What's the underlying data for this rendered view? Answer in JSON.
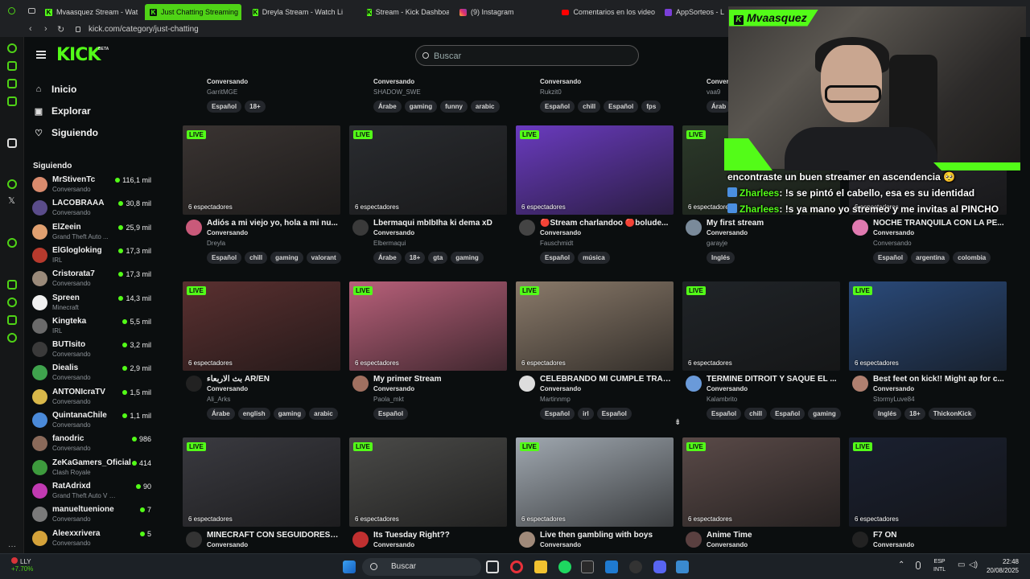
{
  "browser": {
    "tabs": [
      {
        "label": "Mvaasquez Stream - Wat",
        "icon": "kick-favicon"
      },
      {
        "label": "Just Chatting Streaming",
        "icon": "kick-favicon",
        "active": true
      },
      {
        "label": "Dreyla Stream - Watch Li",
        "icon": "kick-favicon"
      },
      {
        "label": "Stream - Kick Dashboard",
        "icon": "kick-favicon"
      },
      {
        "label": "(9) Instagram",
        "icon": "instagram-favicon"
      },
      {
        "label": "Comentarios en los video",
        "icon": "youtube-favicon"
      },
      {
        "label": "AppSorteos - L",
        "icon": "app-favicon"
      }
    ],
    "url": "kick.com/category/just-chatting"
  },
  "header": {
    "logo": "KICK",
    "beta": "BETA",
    "search_placeholder": "Buscar"
  },
  "sidebar": {
    "nav": [
      {
        "label": "Inicio",
        "icon": "home-icon"
      },
      {
        "label": "Explorar",
        "icon": "explore-icon"
      },
      {
        "label": "Siguiendo",
        "icon": "heart-icon"
      }
    ],
    "following_title": "Siguiendo",
    "following": [
      {
        "name": "MrStivenTc",
        "game": "Conversando",
        "viewers": "116,1 mil",
        "color": "#d98b6d"
      },
      {
        "name": "LACOBRAAA",
        "game": "Conversando",
        "viewers": "30,8 mil",
        "color": "#5a4c8a"
      },
      {
        "name": "ElZeein",
        "game": "Grand Theft Auto ...",
        "viewers": "25,9 mil",
        "color": "#e0a070"
      },
      {
        "name": "ElGlogloking",
        "game": "IRL",
        "viewers": "17,3 mil",
        "color": "#b73a2d"
      },
      {
        "name": "Cristorata7",
        "game": "Conversando",
        "viewers": "17,3 mil",
        "color": "#9a8a7a"
      },
      {
        "name": "Spreen",
        "game": "Minecraft",
        "viewers": "14,3 mil",
        "color": "#f0f0f0"
      },
      {
        "name": "Kingteka",
        "game": "IRL",
        "viewers": "5,5 mil",
        "color": "#6a6a6a"
      },
      {
        "name": "BUTIsito",
        "game": "Conversando",
        "viewers": "3,2 mil",
        "color": "#3a3a3a"
      },
      {
        "name": "Diealis",
        "game": "Conversando",
        "viewers": "2,9 mil",
        "color": "#3fa34d"
      },
      {
        "name": "ANTONIcraTV",
        "game": "Conversando",
        "viewers": "1,5 mil",
        "color": "#d9b84a"
      },
      {
        "name": "QuintanaChile",
        "game": "Conversando",
        "viewers": "1,1 mil",
        "color": "#4a8ad9"
      },
      {
        "name": "fanodric",
        "game": "Conversando",
        "viewers": "986",
        "color": "#8a6a5a"
      },
      {
        "name": "ZeKaGamers_Oficial",
        "game": "Clash Royale",
        "viewers": "414",
        "color": "#3d9a3d"
      },
      {
        "name": "RatAdrixd",
        "game": "Grand Theft Auto V (GTA)",
        "viewers": "90",
        "color": "#c13ab2"
      },
      {
        "name": "manueltuenione",
        "game": "Conversando",
        "viewers": "7",
        "color": "#7a7a7a"
      },
      {
        "name": "Aleexxrivera",
        "game": "Conversando",
        "viewers": "5",
        "color": "#d4a23a"
      }
    ]
  },
  "top_partial_row": [
    {
      "category": "Conversando",
      "user": "GarritMGE",
      "tags": [
        "Español",
        "18+"
      ]
    },
    {
      "category": "Conversando",
      "user": "SHADOW_SWE",
      "tags": [
        "Árabe",
        "gaming",
        "funny",
        "arabic"
      ]
    },
    {
      "category": "Conversando",
      "user": "Rukzit0",
      "tags": [
        "Español",
        "chill",
        "Español",
        "fps"
      ]
    },
    {
      "category": "Conversando",
      "user": "vaa9",
      "tags": [
        "Árab"
      ]
    }
  ],
  "streams": [
    {
      "title": "Adiós a mi viejo yo, hola a mi nu...",
      "category": "Conversando",
      "user": "Dreyla",
      "viewers": "6 espectadores",
      "tags": [
        "Español",
        "chill",
        "gaming",
        "valorant"
      ],
      "thumb": "#3a3432",
      "av": "#c95a7a"
    },
    {
      "title": "Lbermaqui mbIbIha ki dema xD",
      "category": "Conversando",
      "user": "Elbermaqui",
      "viewers": "6 espectadores",
      "tags": [
        "Árabe",
        "18+",
        "gta",
        "gaming"
      ],
      "thumb": "#2a2c30",
      "av": "#3a3a3a"
    },
    {
      "title": "🔴Stream charlandoo 🔴bolude...",
      "category": "Conversando",
      "user": "Fauschmidt",
      "viewers": "6 espectadores",
      "tags": [
        "Español",
        "música"
      ],
      "thumb": "#6a3bbf",
      "av": "#444"
    },
    {
      "title": "My first stream",
      "category": "Conversando",
      "user": "garayje",
      "viewers": "6 espectadores",
      "tags": [
        "Inglés"
      ],
      "thumb": "#2c3a2a",
      "av": "#7a8a9a"
    },
    {
      "title": "NOCHE TRANQUILA CON LA PE...",
      "category": "Conversando",
      "user": "Conversando",
      "viewers": "6 espectadores",
      "tags": [
        "Español",
        "argentina",
        "colombia"
      ],
      "thumb": "#2a2a30",
      "av": "#e07ab0"
    },
    {
      "title": "بث الاربعاء AR/EN",
      "category": "Conversando",
      "user": "Ali_Arks",
      "viewers": "6 espectadores",
      "tags": [
        "Árabe",
        "english",
        "gaming",
        "arabic"
      ],
      "thumb": "#5a3030",
      "av": "#222"
    },
    {
      "title": "My primer Stream",
      "category": "Conversando",
      "user": "Paola_mkt",
      "viewers": "6 espectadores",
      "tags": [
        "Español"
      ],
      "thumb": "#b8607a",
      "av": "#a07060"
    },
    {
      "title": "CELEBRANDO MI CUMPLE TRAN...",
      "category": "Conversando",
      "user": "Martinnmp",
      "viewers": "6 espectadores",
      "tags": [
        "Español",
        "irl",
        "Español"
      ],
      "thumb": "#8a7a6a",
      "av": "#ddd"
    },
    {
      "title": "TERMINE DITROIT Y SAQUE EL ...",
      "category": "Conversando",
      "user": "Kalambrito",
      "viewers": "6 espectadores",
      "tags": [
        "Español",
        "chill",
        "Español",
        "gaming"
      ],
      "thumb": "#202428",
      "av": "#6a9ad9"
    },
    {
      "title": "Best feet on kick!! Might ap for c...",
      "category": "Conversando",
      "user": "StormyLuve84",
      "viewers": "6 espectadores",
      "tags": [
        "Inglés",
        "18+",
        "ThickonKick"
      ],
      "thumb": "#2a4a7a",
      "av": "#b08070"
    },
    {
      "title": "MINECRAFT CON SEGUIDORES !...",
      "category": "Conversando",
      "user": "",
      "viewers": "6 espectadores",
      "tags": [],
      "thumb": "#3a3a40",
      "av": "#333"
    },
    {
      "title": "Its Tuesday Right??",
      "category": "Conversando",
      "user": "",
      "viewers": "6 espectadores",
      "tags": [],
      "thumb": "#4a4a48",
      "av": "#c03030"
    },
    {
      "title": "Live then gambling with boys",
      "category": "Conversando",
      "user": "",
      "viewers": "6 espectadores",
      "tags": [],
      "thumb": "#a0a8b0",
      "av": "#a08a7a"
    },
    {
      "title": "Anime Time",
      "category": "Conversando",
      "user": "",
      "viewers": "6 espectadores",
      "tags": [],
      "thumb": "#5a4a48",
      "av": "#5a4040"
    },
    {
      "title": "F7 ON",
      "category": "Conversando",
      "user": "",
      "viewers": "6 espectadores",
      "tags": [],
      "thumb": "#1a2030",
      "av": "#222"
    }
  ],
  "live_label": "LIVE",
  "overlay": {
    "streamer": "Mvaasquez"
  },
  "chat": [
    {
      "user": "",
      "text": "encontraste un buen streamer en ascendencia 🥺"
    },
    {
      "user": "Zharlees",
      "text": ": !s se pintó el cabello, esa es su identidad"
    },
    {
      "user": "Zharlees",
      "text": ": !s ya mano yo stremeo y me invitas al PINCHO"
    }
  ],
  "taskbar": {
    "weather_label": "LLY",
    "weather_change": "+7.70%",
    "search": "Buscar",
    "lang": "ESP",
    "lang2": "INTL",
    "time": "22:48",
    "date": "20/08/2025"
  }
}
